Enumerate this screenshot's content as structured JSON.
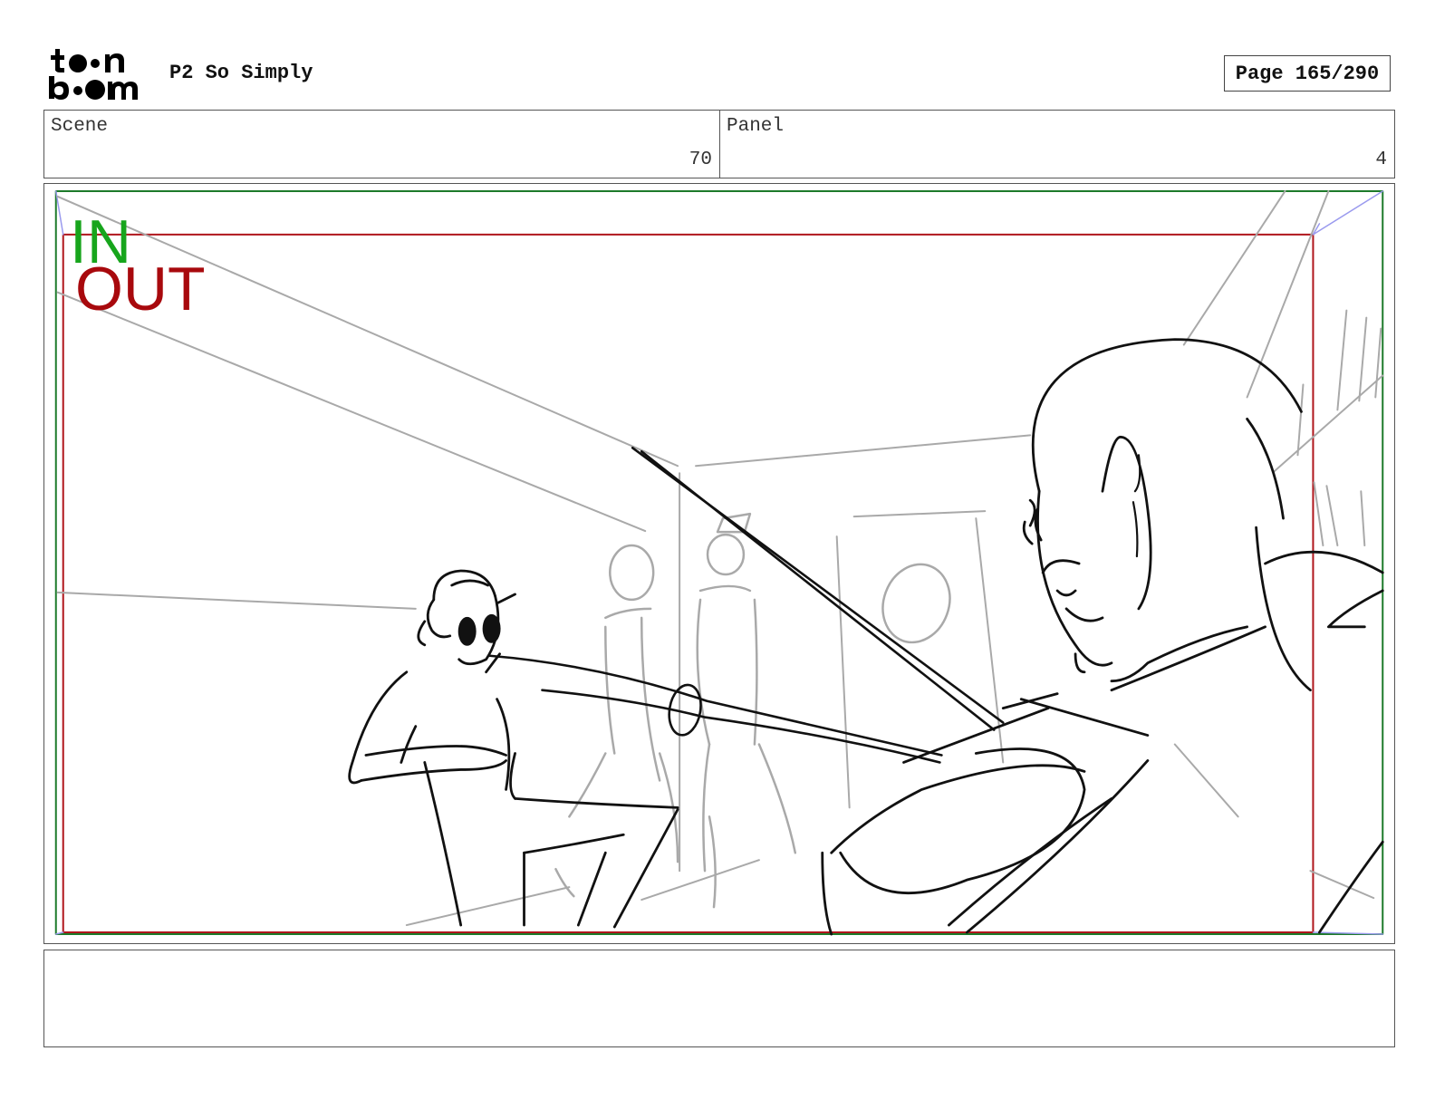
{
  "header": {
    "logo_text_top": "toon",
    "logo_text_bottom": "boom",
    "project_title": "P2 So Simply",
    "page_indicator": "Page 165/290"
  },
  "info": {
    "scene_label": "Scene",
    "scene_value": "70",
    "panel_label": "Panel",
    "panel_value": "4"
  },
  "frame": {
    "in_label": "IN",
    "out_label": "OUT",
    "in_color": "#17a51c",
    "out_color": "#a8090d"
  },
  "notes": {
    "text": ""
  }
}
